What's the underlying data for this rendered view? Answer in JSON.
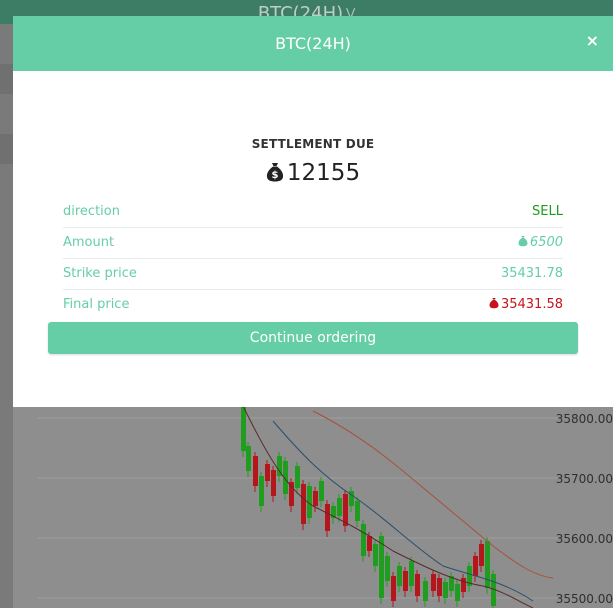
{
  "background": {
    "top_bar_title": "BTC(24H)",
    "price_axis": [
      "35800.00",
      "35700.00",
      "35600.00",
      "35500.00"
    ]
  },
  "modal": {
    "title": "BTC(24H)",
    "close_symbol": "×",
    "settlement_label": "SETTLEMENT DUE",
    "settlement_amount": "12155",
    "rows": [
      {
        "label": "direction",
        "value": "SELL"
      },
      {
        "label": "Amount",
        "value": "6500"
      },
      {
        "label": "Strike price",
        "value": "35431.78"
      },
      {
        "label": "Final price",
        "value": "35431.58"
      }
    ],
    "continue_label": "Continue ordering"
  },
  "colors": {
    "accent": "#66cea6",
    "sell": "#1c9c1c",
    "loss": "#c6151a"
  }
}
